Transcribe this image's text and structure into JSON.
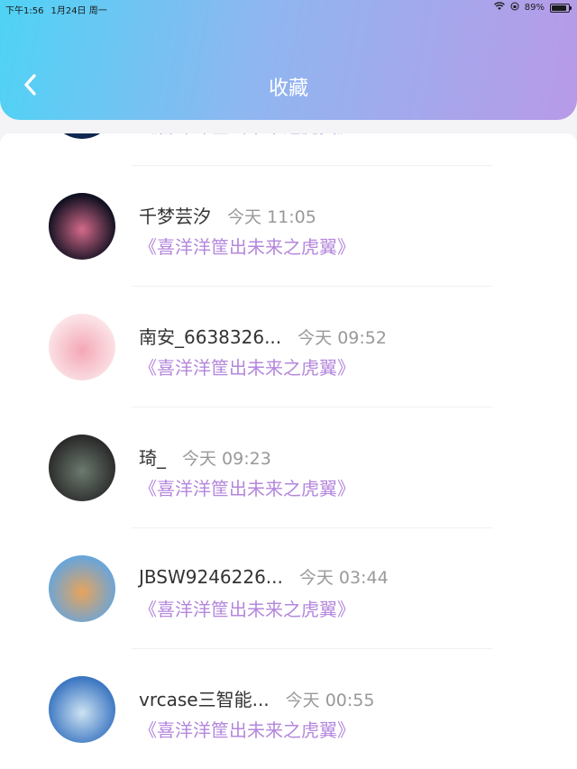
{
  "status": {
    "time": "下午1:56",
    "date": "1月24日 周一",
    "battery": "89%",
    "battery_level": 0.89
  },
  "header": {
    "title": "收藏",
    "back_icon": "chevron-left-icon"
  },
  "items": [
    {
      "name": "",
      "time": "",
      "book": "《喜洋洋筐出未来之虎翼》",
      "avatar_colors": [
        "#0a1a3a",
        "#2a5aa8"
      ]
    },
    {
      "name": "千梦芸汐",
      "time": "今天 11:05",
      "book": "《喜洋洋筐出未来之虎翼》",
      "avatar_colors": [
        "#101020",
        "#d46a8a"
      ]
    },
    {
      "name": "南安_6638326...",
      "time": "今天 09:52",
      "book": "《喜洋洋筐出未来之虎翼》",
      "avatar_colors": [
        "#fbe3e6",
        "#f4a7b6"
      ]
    },
    {
      "name": "琦_",
      "time": "今天 09:23",
      "book": "《喜洋洋筐出未来之虎翼》",
      "avatar_colors": [
        "#2b2b2b",
        "#6b7a6e"
      ]
    },
    {
      "name": "JBSW9246226...",
      "time": "今天 03:44",
      "book": "《喜洋洋筐出未来之虎翼》",
      "avatar_colors": [
        "#6aa5d8",
        "#e8a35c"
      ]
    },
    {
      "name": "vrcase三智能...",
      "time": "今天 00:55",
      "book": "《喜洋洋筐出未来之虎翼》",
      "avatar_colors": [
        "#3d77c2",
        "#cde3f2"
      ]
    }
  ]
}
